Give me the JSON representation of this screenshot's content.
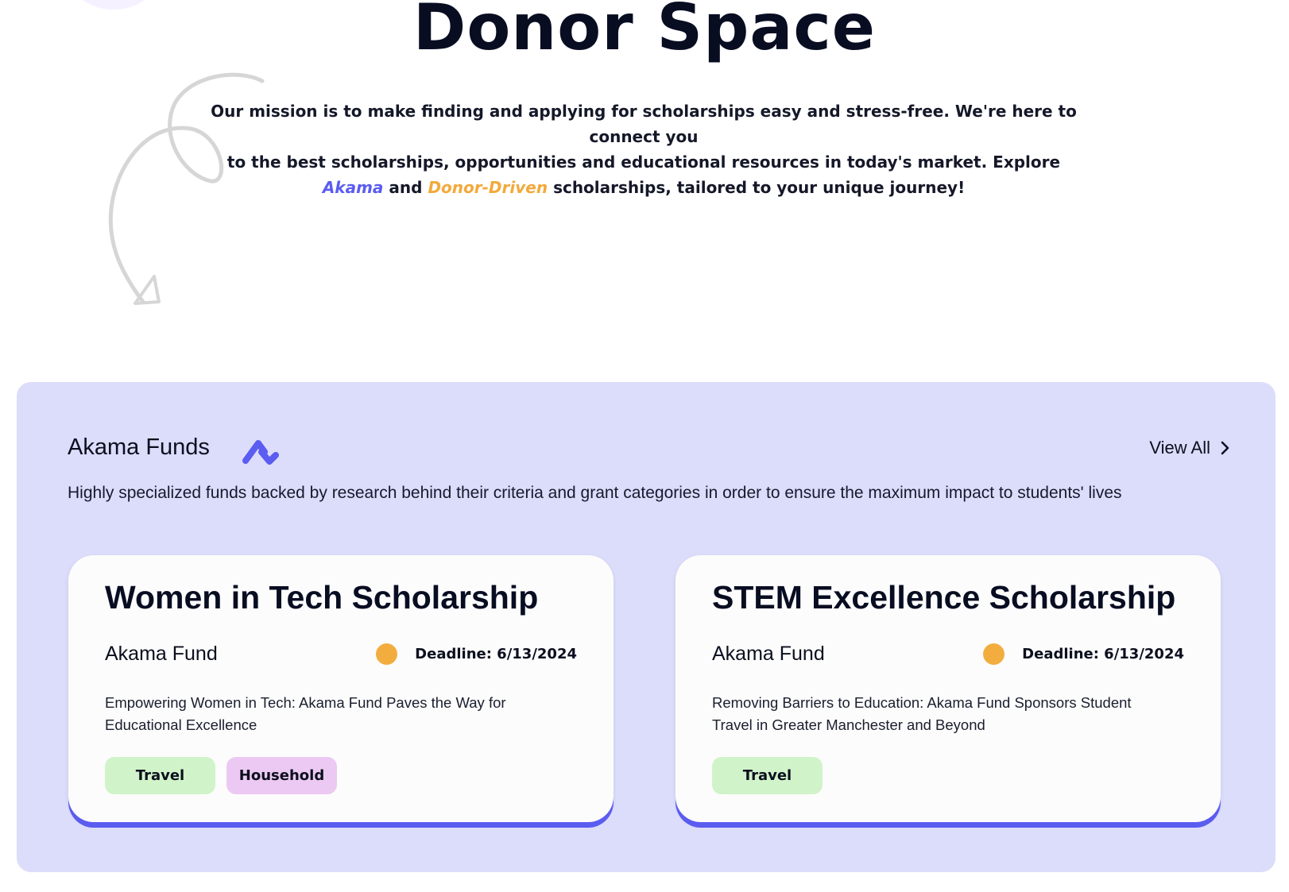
{
  "hero": {
    "title": "Donor Space",
    "mission_line1": "Our mission is to make finding and applying for scholarships easy and stress-free. We're here to connect you",
    "mission_line2": "to the best scholarships, opportunities and educational resources in today's market. Explore",
    "highlight_akama": "Akama",
    "conj": "and",
    "highlight_donor": "Donor-Driven",
    "mission_tail": "scholarships, tailored to your unique journey!"
  },
  "funds_section": {
    "title": "Akama Funds",
    "view_all_label": "View All",
    "description": "Highly specialized funds backed by research behind their criteria and grant categories in order to ensure the maximum impact to students' lives",
    "cards": [
      {
        "title": "Women in Tech Scholarship",
        "fund": "Akama Fund",
        "deadline": "Deadline: 6/13/2024",
        "description": "Empowering Women in Tech: Akama Fund Paves the Way for Educational Excellence",
        "tags": [
          "Travel",
          "Household"
        ]
      },
      {
        "title": "STEM Excellence Scholarship",
        "fund": "Akama Fund",
        "deadline": "Deadline: 6/13/2024",
        "description": "Removing Barriers to Education: Akama Fund Sponsors Student Travel in Greater Manchester and Beyond",
        "tags": [
          "Travel"
        ]
      }
    ]
  },
  "colors": {
    "brand_accent": "#5b5cf0",
    "donor_accent": "#f3a93a",
    "panel_bg": "#dcdcfb",
    "tag_travel": "#d1f3c9",
    "tag_household": "#ecc9f2",
    "status_dot": "#f3ad3f"
  },
  "icons": {
    "brand_logo": "akama-logo-icon",
    "view_all_chevron": "chevron-right-icon",
    "decorative_arrow": "curly-arrow-icon"
  }
}
